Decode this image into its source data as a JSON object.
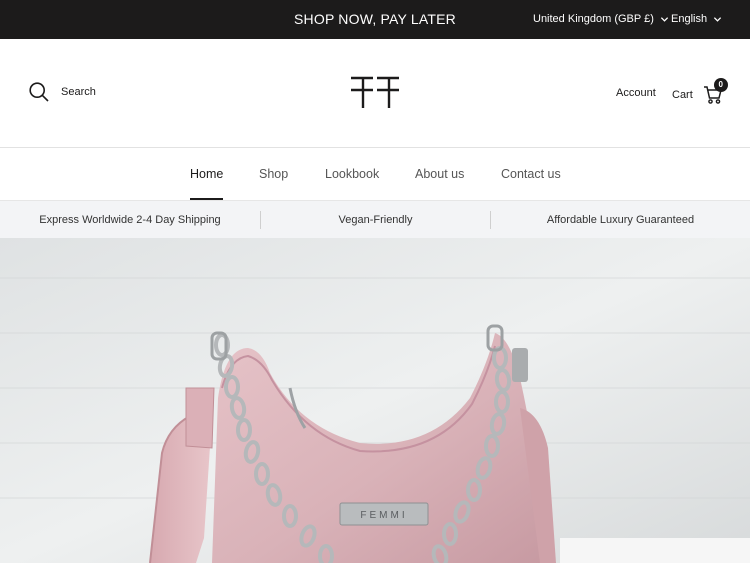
{
  "announcement": {
    "promo_text": "SHOP NOW, PAY LATER",
    "country_selector": "United Kingdom (GBP £)",
    "language_selector": "English"
  },
  "header": {
    "search_label": "Search",
    "account_label": "Account",
    "cart_label": "Cart",
    "cart_count": "0",
    "logo_icon": "femmi-ff-monogram"
  },
  "nav": {
    "items": [
      {
        "label": "Home",
        "active": true
      },
      {
        "label": "Shop"
      },
      {
        "label": "Lookbook"
      },
      {
        "label": "About us"
      },
      {
        "label": "Contact us"
      }
    ]
  },
  "usp": {
    "items": [
      "Express Worldwide 2-4 Day Shipping",
      "Vegan-Friendly",
      "Affordable Luxury Guaranteed"
    ]
  },
  "hero": {
    "image_subject": "pink shoulder bag with silver chain",
    "plate_text": "FEMMI"
  },
  "colors": {
    "topbar_bg": "#1c1b1b",
    "text": "#1c1b1b",
    "usp_bg": "#f3f4f6",
    "bag_pink": "#d9b2b8"
  }
}
